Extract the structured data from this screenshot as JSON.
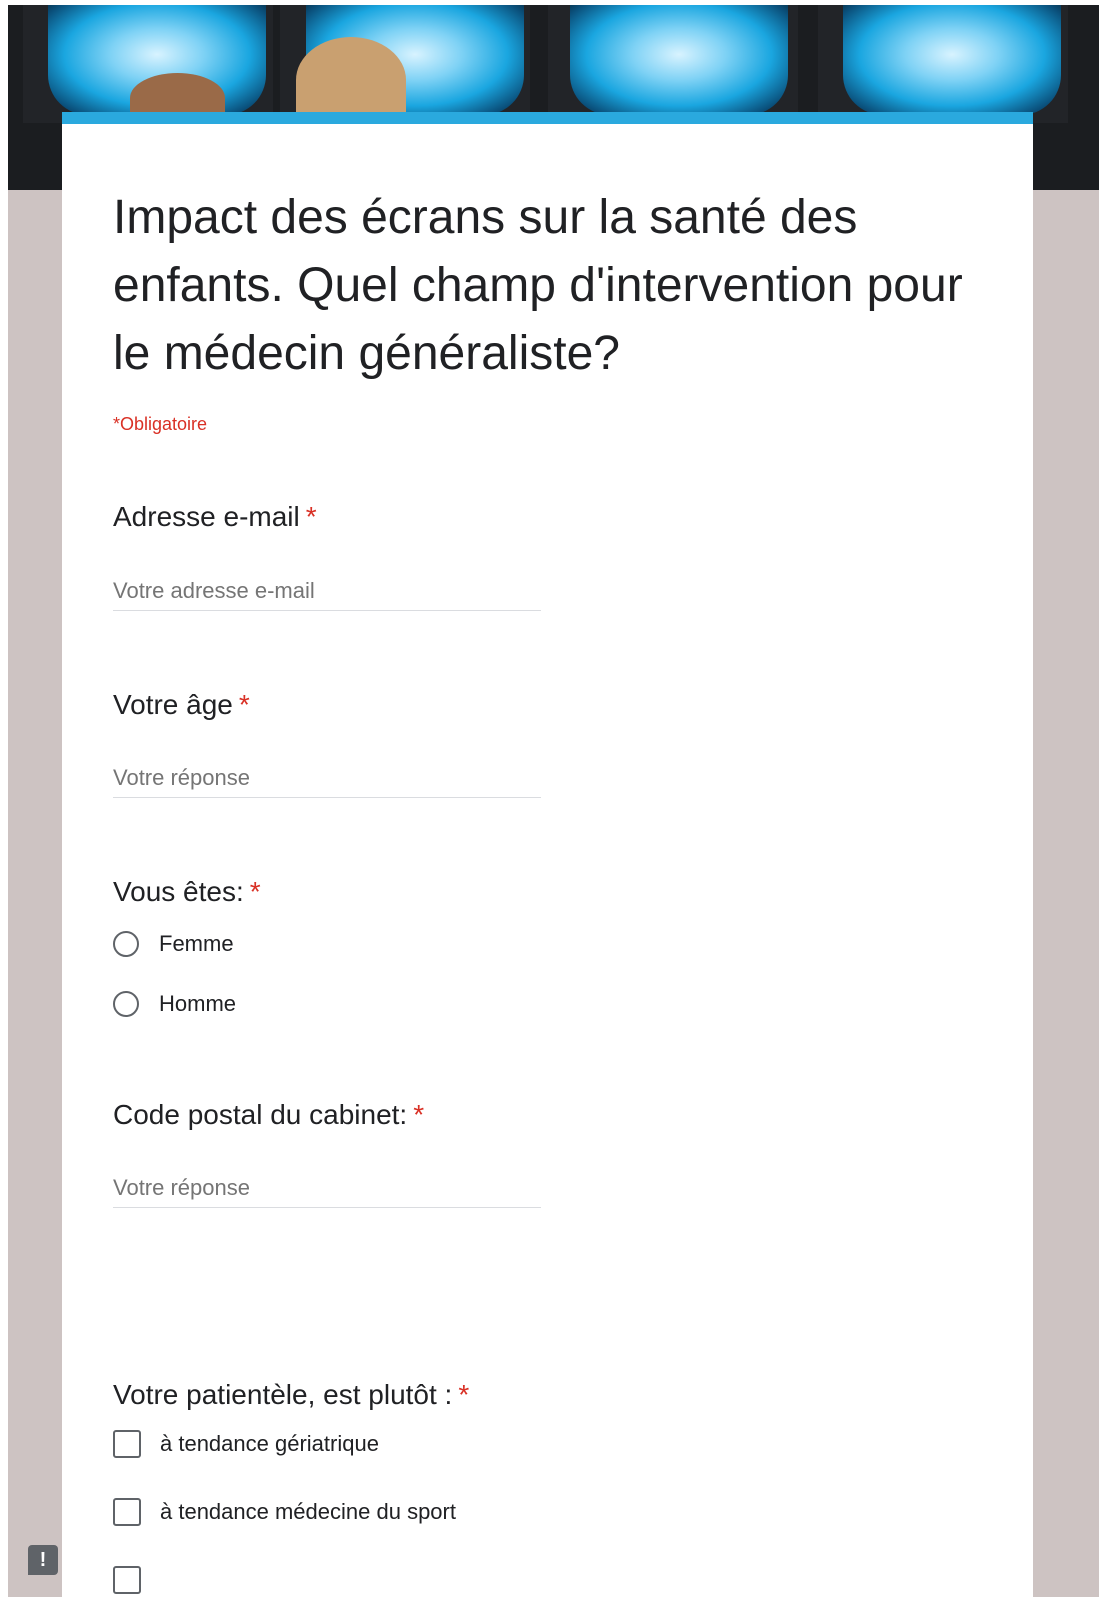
{
  "form": {
    "title": "Impact des écrans sur la santé des enfants. Quel champ d'intervention pour le médecin généraliste?",
    "required_note": "*Obligatoire",
    "asterisk": "*"
  },
  "questions": {
    "email": {
      "label": "Adresse e-mail",
      "placeholder": "Votre adresse e-mail"
    },
    "age": {
      "label": "Votre âge",
      "placeholder": "Votre réponse"
    },
    "gender": {
      "label": "Vous êtes:",
      "options": [
        "Femme",
        "Homme"
      ]
    },
    "postal_code": {
      "label": "Code postal du cabinet:",
      "placeholder": "Votre réponse"
    },
    "patients": {
      "label": "Votre patientèle, est plutôt :",
      "options": [
        "à tendance gériatrique",
        "à tendance médecine du sport"
      ]
    }
  },
  "colors": {
    "accent": "#2aa9de",
    "required": "#d93025",
    "background": "#cdc3c2"
  },
  "icons": {
    "feedback": "feedback-icon"
  },
  "feedback": {
    "glyph": "!"
  }
}
